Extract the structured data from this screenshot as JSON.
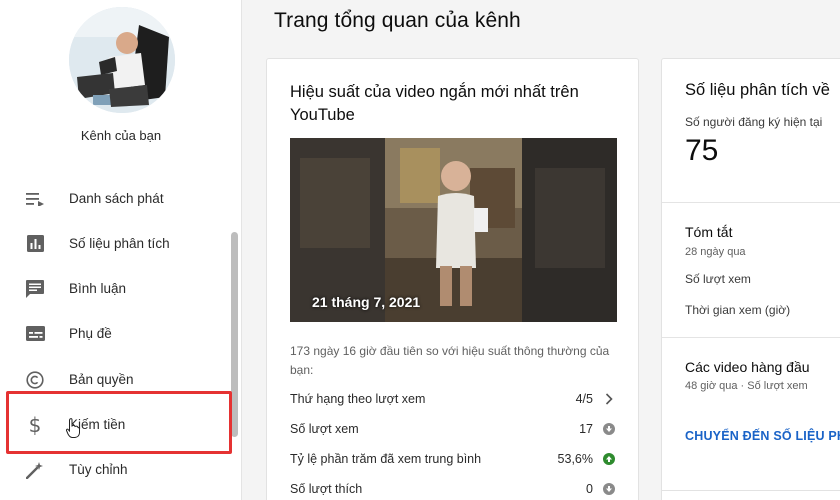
{
  "sidebar": {
    "channel_label": "Kênh của bạn",
    "items": [
      {
        "label": "Danh sách phát",
        "icon": "playlist-icon"
      },
      {
        "label": "Số liệu phân tích",
        "icon": "analytics-icon"
      },
      {
        "label": "Bình luận",
        "icon": "comment-icon"
      },
      {
        "label": "Phụ đề",
        "icon": "subtitles-icon"
      },
      {
        "label": "Bản quyền",
        "icon": "copyright-icon"
      },
      {
        "label": "Kiếm tiền",
        "icon": "dollar-icon"
      },
      {
        "label": "Tùy chỉnh",
        "icon": "magic-wand-icon"
      }
    ]
  },
  "page_title": "Trang tổng quan của kênh",
  "latest_short": {
    "title": "Hiệu suất của video ngắn mới nhất trên YouTube",
    "thumbnail_date": "21 tháng 7, 2021",
    "description": "173 ngày 16 giờ đầu tiên so với hiệu suất thông thường của bạn:",
    "rows": [
      {
        "label": "Thứ hạng theo lượt xem",
        "value": "4/5",
        "icon": "chevron-right-icon"
      },
      {
        "label": "Số lượt xem",
        "value": "17",
        "icon": "arrow-down-icon"
      },
      {
        "label": "Tỷ lệ phần trăm đã xem trung bình",
        "value": "53,6%",
        "icon": "arrow-up-icon"
      },
      {
        "label": "Số lượt thích",
        "value": "0",
        "icon": "arrow-down-icon"
      }
    ]
  },
  "analytics": {
    "title": "Số liệu phân tích về",
    "subscribers_label": "Số người đăng ký hiện tại",
    "subscribers_value": "75",
    "summary_title": "Tóm tắt",
    "summary_period": "28 ngày qua",
    "summary_views": "Số lượt xem",
    "summary_watch_time": "Thời gian xem (giờ)",
    "top_videos_title": "Các video hàng đầu",
    "top_videos_sub": "48 giờ qua · Số lượt xem",
    "link": "CHUYỂN ĐẾN SỐ LIỆU PH"
  },
  "colors": {
    "highlight": "#e53232",
    "link": "#1a63c7",
    "up": "#2e8b2e",
    "down": "#8a8a8a"
  }
}
